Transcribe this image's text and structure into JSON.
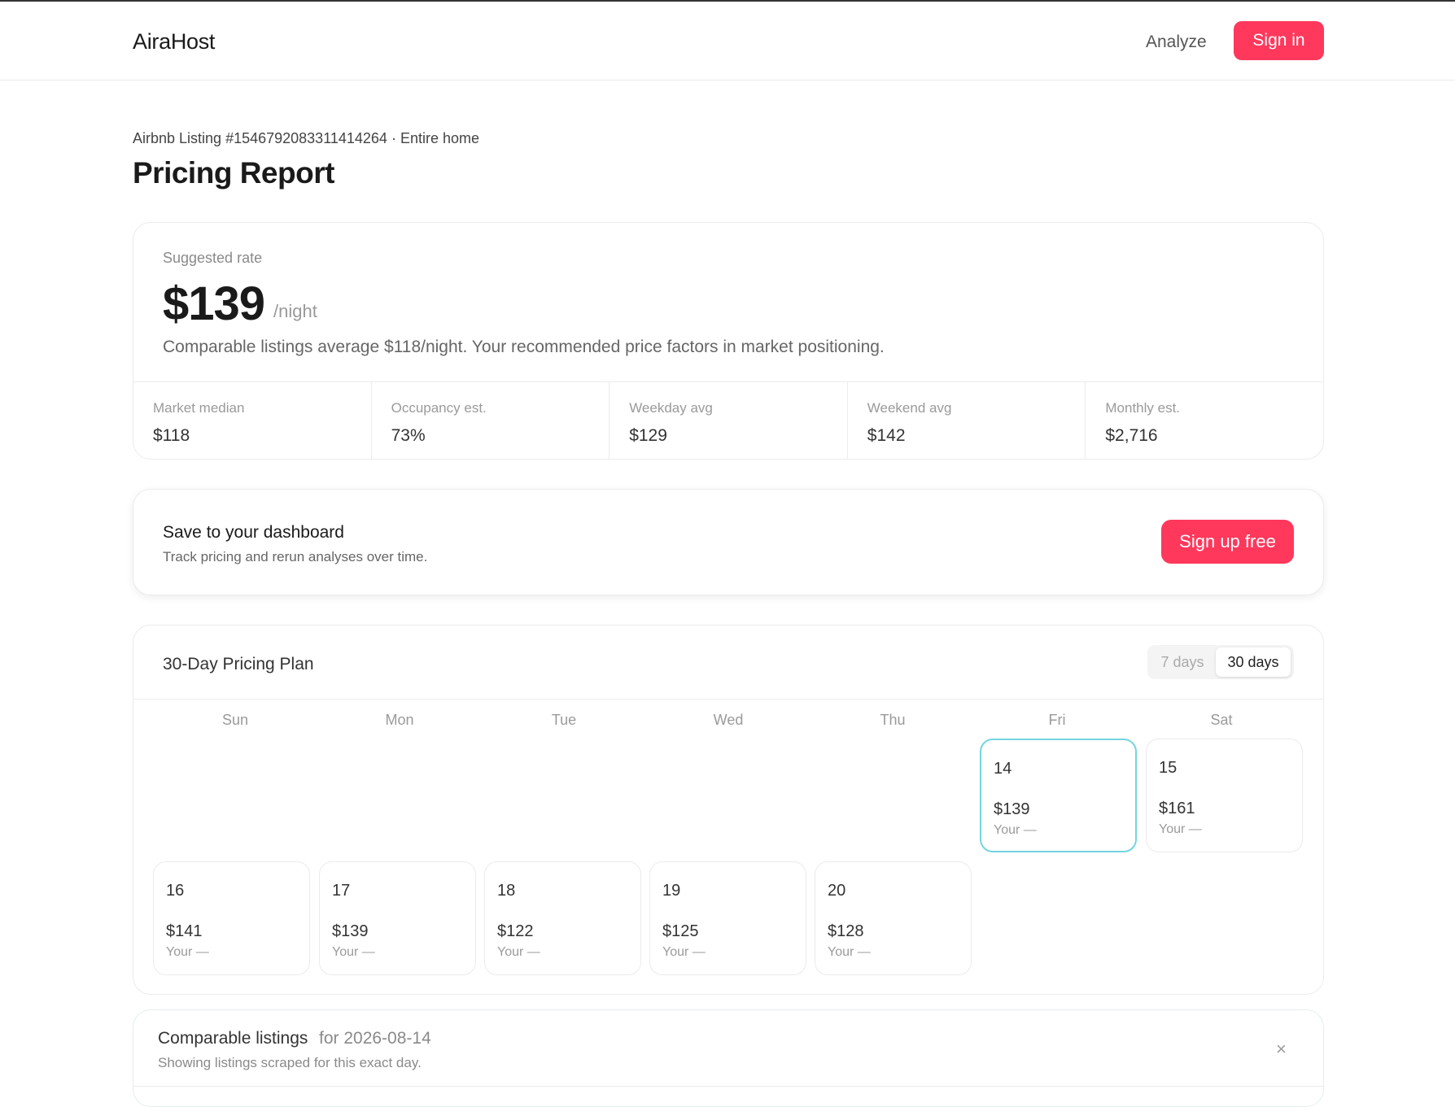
{
  "header": {
    "logo": "AiraHost",
    "nav_analyze": "Analyze",
    "signin_label": "Sign in"
  },
  "page": {
    "subtitle": "Airbnb Listing #1546792083311414264 · Entire home",
    "title": "Pricing Report"
  },
  "rate": {
    "label": "Suggested rate",
    "value": "$139",
    "unit": "/night",
    "description": "Comparable listings average $118/night. Your recommended price factors in market positioning."
  },
  "stats": [
    {
      "label": "Market median",
      "value": "$118"
    },
    {
      "label": "Occupancy est.",
      "value": "73%"
    },
    {
      "label": "Weekday avg",
      "value": "$129"
    },
    {
      "label": "Weekend avg",
      "value": "$142"
    },
    {
      "label": "Monthly est.",
      "value": "$2,716"
    }
  ],
  "save": {
    "title": "Save to your dashboard",
    "description": "Track pricing and rerun analyses over time.",
    "button": "Sign up free"
  },
  "plan": {
    "title": "30-Day Pricing Plan",
    "toggle_7": "7 days",
    "toggle_30": "30 days",
    "weekdays": [
      "Sun",
      "Mon",
      "Tue",
      "Wed",
      "Thu",
      "Fri",
      "Sat"
    ],
    "days": [
      {
        "num": "14",
        "price": "$139",
        "your": "Your —"
      },
      {
        "num": "15",
        "price": "$161",
        "your": "Your —"
      },
      {
        "num": "16",
        "price": "$141",
        "your": "Your —"
      },
      {
        "num": "17",
        "price": "$139",
        "your": "Your —"
      },
      {
        "num": "18",
        "price": "$122",
        "your": "Your —"
      },
      {
        "num": "19",
        "price": "$125",
        "your": "Your —"
      },
      {
        "num": "20",
        "price": "$128",
        "your": "Your —"
      }
    ]
  },
  "comparable": {
    "title": "Comparable listings",
    "date": "for 2026-08-14",
    "description": "Showing listings scraped for this exact day.",
    "close_icon": "×"
  },
  "colors": {
    "accent": "#ff385c",
    "selected_border": "#74d4e2"
  }
}
